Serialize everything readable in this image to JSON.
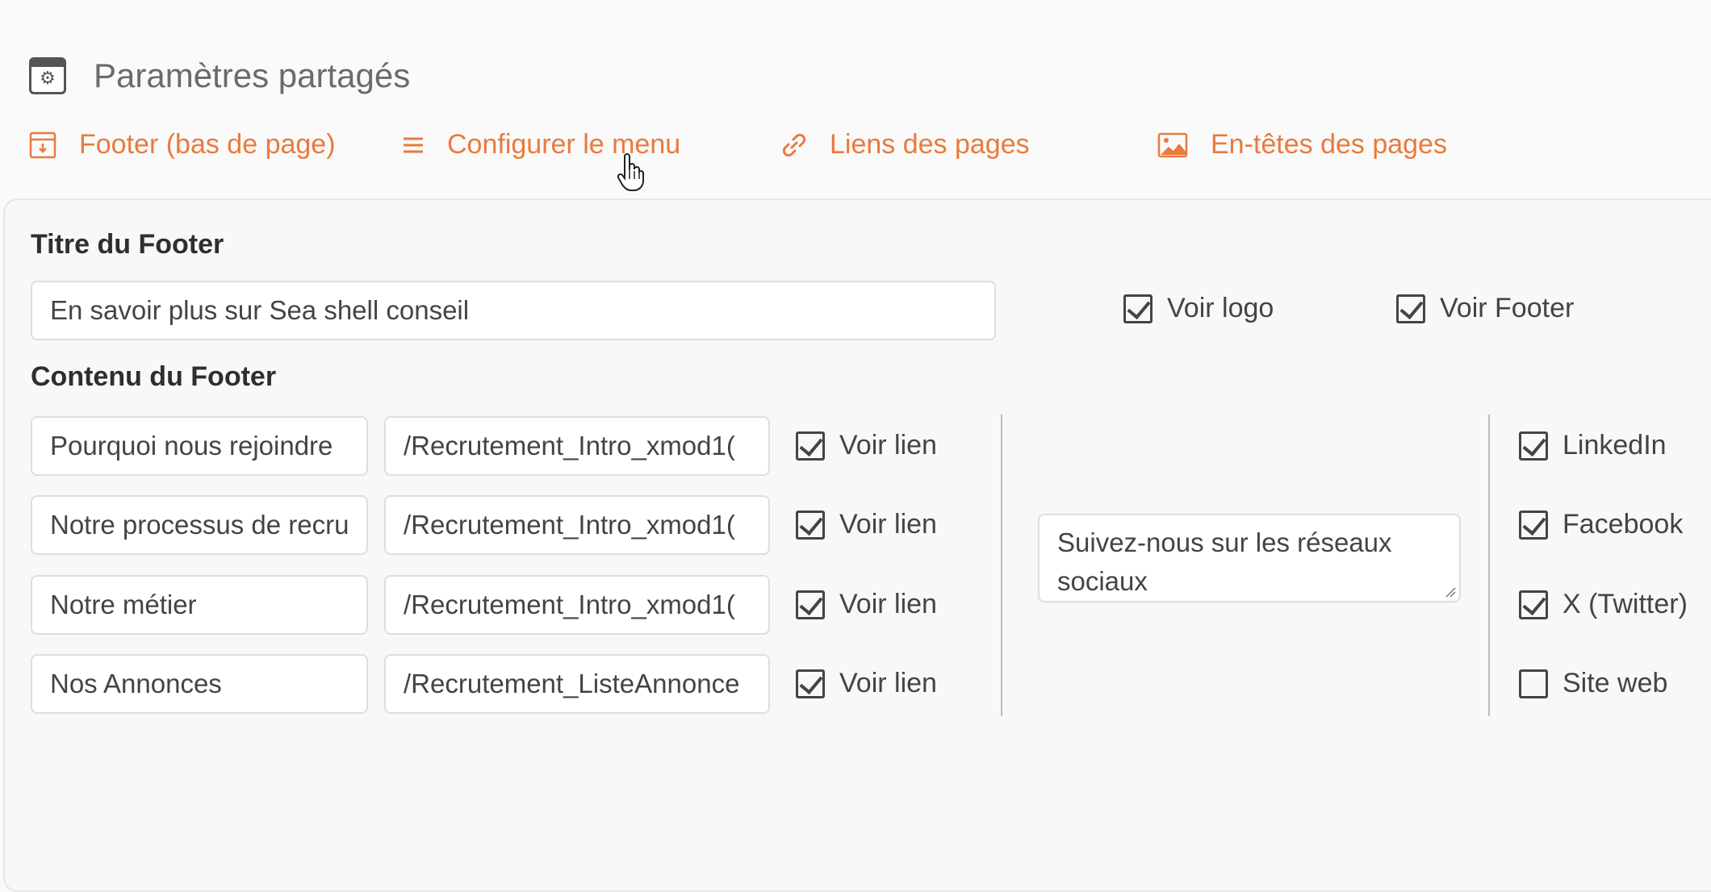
{
  "header": {
    "title": "Paramètres partagés",
    "icon": "settings-window-icon"
  },
  "tabs": [
    {
      "label": "Footer (bas de page)",
      "icon": "footer-layout-icon",
      "color": "#ea7a3c"
    },
    {
      "label": "Configurer le menu",
      "icon": "menu-lines-icon",
      "color": "#ea7a3c"
    },
    {
      "label": "Liens des pages",
      "icon": "link-icon",
      "color": "#ea7a3c"
    },
    {
      "label": "En-têtes des pages",
      "icon": "image-icon",
      "color": "#ea7a3c"
    }
  ],
  "footer_title": {
    "label": "Titre du Footer",
    "value": "En savoir plus sur Sea shell conseil",
    "show_logo": {
      "label": "Voir logo",
      "checked": true
    },
    "show_footer": {
      "label": "Voir Footer",
      "checked": true
    }
  },
  "footer_content": {
    "label": "Contenu du Footer",
    "rows": [
      {
        "title": "Pourquoi nous rejoindre",
        "url": "/Recrutement_Intro_xmod1(",
        "show_link": {
          "label": "Voir lien",
          "checked": true
        }
      },
      {
        "title": "Notre processus de recru",
        "url": "/Recrutement_Intro_xmod1(",
        "show_link": {
          "label": "Voir lien",
          "checked": true
        }
      },
      {
        "title": "Notre métier",
        "url": "/Recrutement_Intro_xmod1(",
        "show_link": {
          "label": "Voir lien",
          "checked": true
        }
      },
      {
        "title": "Nos Annonces",
        "url": "/Recrutement_ListeAnnonce",
        "show_link": {
          "label": "Voir lien",
          "checked": true
        }
      }
    ],
    "social_text": "Suivez-nous sur les réseaux sociaux",
    "social": [
      {
        "label": "LinkedIn",
        "checked": true
      },
      {
        "label": "Facebook",
        "checked": true
      },
      {
        "label": "X (Twitter)",
        "checked": true
      },
      {
        "label": "Site web",
        "checked": false
      }
    ]
  }
}
